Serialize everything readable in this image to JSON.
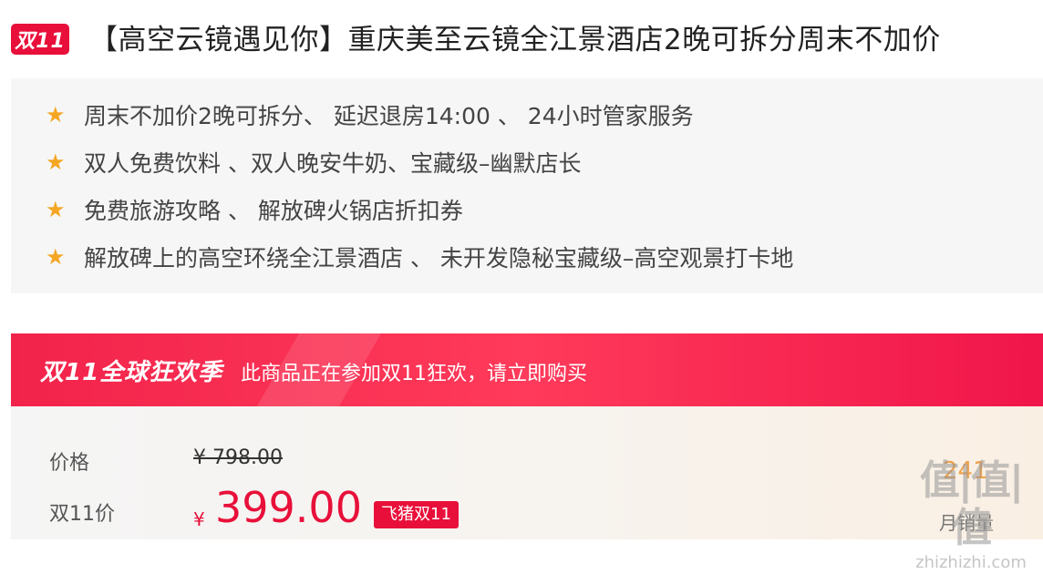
{
  "title": {
    "badge": "双11",
    "text": "【高空云镜遇见你】重庆美至云镜全江景酒店2晚可拆分周末不加价"
  },
  "features": [
    {
      "icon": "star-icon",
      "text": "周末不加价2晚可拆分、 延迟退房14:00 、 24小时管家服务"
    },
    {
      "icon": "star-icon",
      "text": "双人免费饮料 、双人晚安牛奶、宝藏级–幽默店长"
    },
    {
      "icon": "star-icon",
      "text": "免费旅游攻略 、 解放碑火锅店折扣券"
    },
    {
      "icon": "star-icon",
      "text": "解放碑上的高空环绕全江景酒店 、 未开发隐秘宝藏级–高空观景打卡地"
    }
  ],
  "promo": {
    "logo": "双11全球狂欢季",
    "text": "此商品正在参加双11狂欢，请立即购买"
  },
  "price": {
    "original_label": "价格",
    "original_value": "¥ 798.00",
    "current_label": "双11价",
    "currency": "¥",
    "current_value": "399.00",
    "tag": "飞猪双11"
  },
  "sales": {
    "count": "241",
    "label": "月销量"
  },
  "watermark": {
    "big": "值|值|值",
    "small": "zhizhizhi.com"
  },
  "colors": {
    "accent": "#e8103a",
    "star": "#f5a623",
    "sales_count": "#f0a14a"
  }
}
